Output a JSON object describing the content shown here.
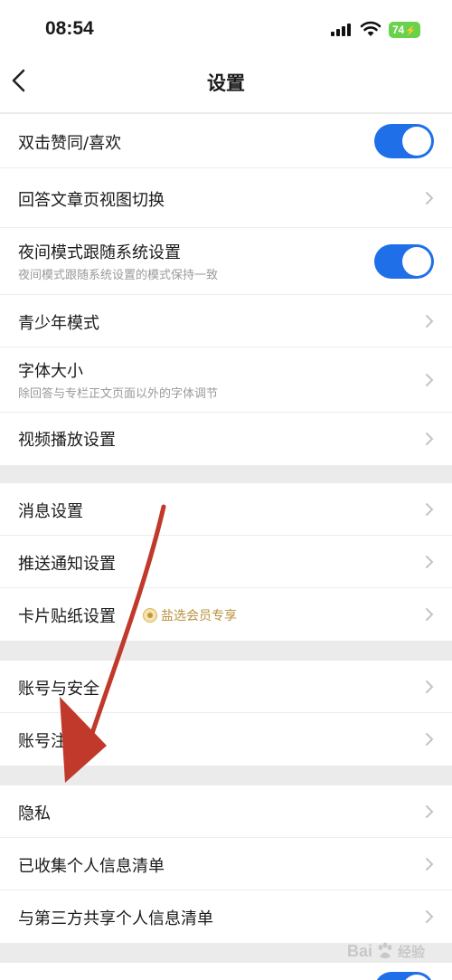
{
  "status_bar": {
    "time": "08:54",
    "battery": "74"
  },
  "nav": {
    "title": "设置"
  },
  "section1": [
    {
      "title": "双击赞同/喜欢",
      "control": "toggle",
      "on": true
    },
    {
      "title": "回答文章页视图切换",
      "control": "chevron"
    },
    {
      "title": "夜间模式跟随系统设置",
      "subtitle": "夜间模式跟随系统设置的模式保持一致",
      "control": "toggle",
      "on": true
    },
    {
      "title": "青少年模式",
      "control": "chevron"
    },
    {
      "title": "字体大小",
      "subtitle": "除回答与专栏正文页面以外的字体调节",
      "control": "chevron"
    },
    {
      "title": "视频播放设置",
      "control": "chevron"
    }
  ],
  "section2": [
    {
      "title": "消息设置",
      "control": "chevron"
    },
    {
      "title": "推送通知设置",
      "control": "chevron"
    },
    {
      "title": "卡片贴纸设置",
      "badge": "盐选会员专享",
      "control": "chevron"
    }
  ],
  "section3": [
    {
      "title": "账号与安全",
      "control": "chevron"
    },
    {
      "title": "账号注销",
      "control": "chevron"
    }
  ],
  "section4": [
    {
      "title": "隐私",
      "control": "chevron"
    },
    {
      "title": "已收集个人信息清单",
      "control": "chevron"
    },
    {
      "title": "与第三方共享个人信息清单",
      "control": "chevron"
    }
  ],
  "watermark": {
    "brand": "Bai",
    "suffix": "经验"
  },
  "colors": {
    "accent": "#1f6fe8",
    "annotation_arrow": "#c0392b",
    "vip_gold": "#b8923b"
  }
}
